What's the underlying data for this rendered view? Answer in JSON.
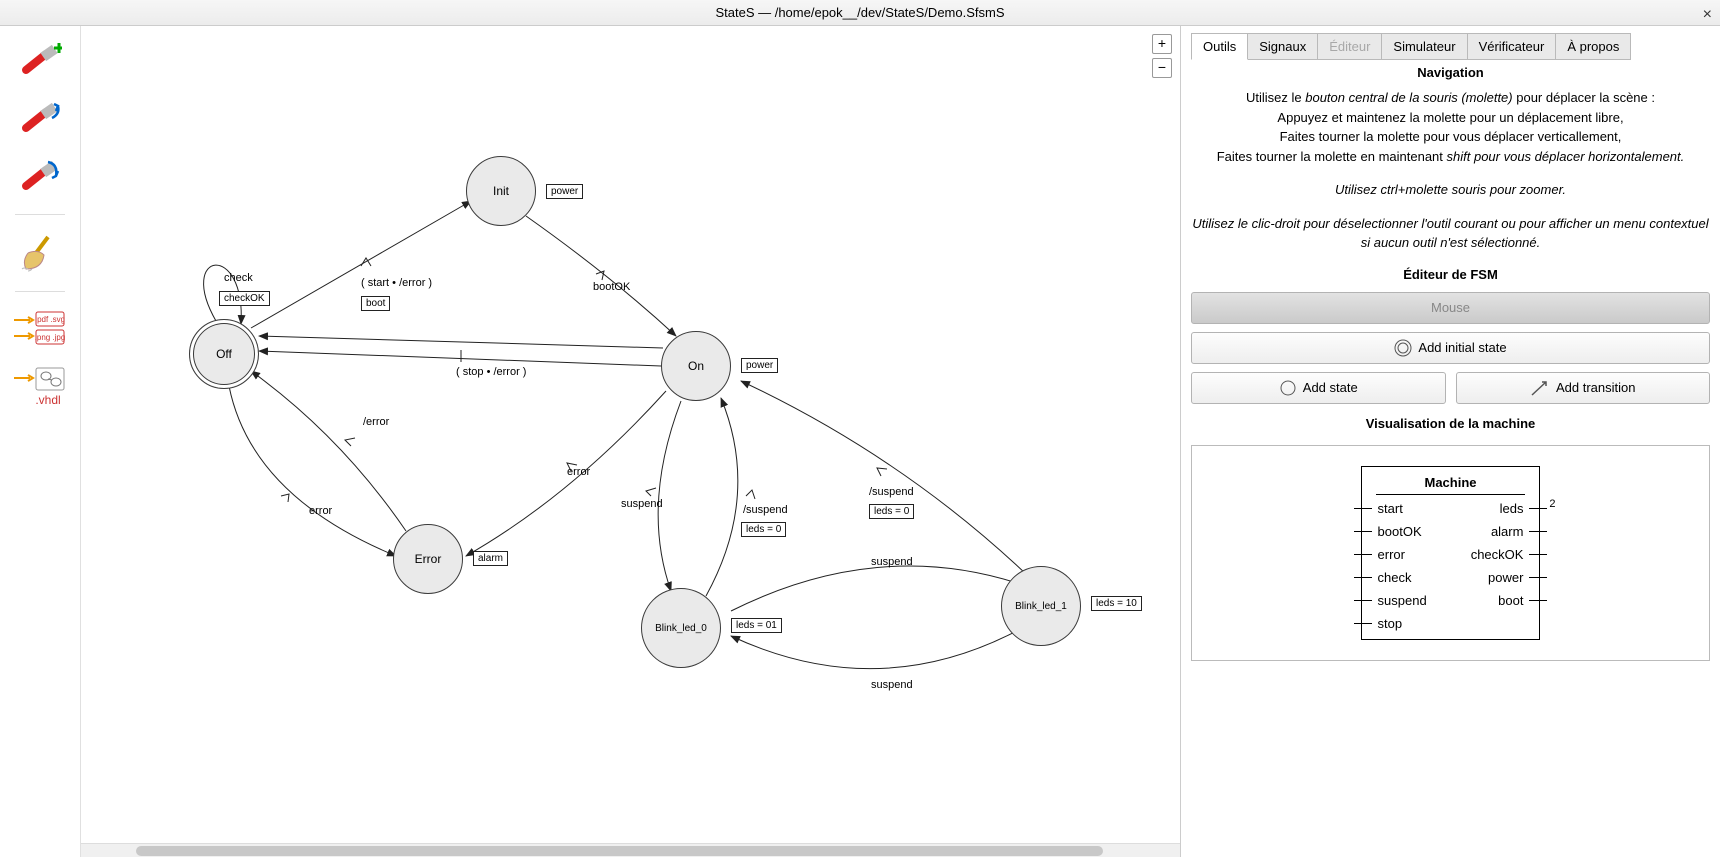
{
  "window": {
    "title": "StateS — /home/epok__/dev/StateS/Demo.SfsmS"
  },
  "zoom": {
    "in": "+",
    "out": "−"
  },
  "states": {
    "init": "Init",
    "off": "Off",
    "on": "On",
    "error": "Error",
    "bl0": "Blink_led_0",
    "bl1": "Blink_led_1"
  },
  "outputs": {
    "init": "power",
    "on": "power",
    "error": "alarm",
    "bl0": "leds = 01",
    "bl1": "leds = 10"
  },
  "edges": {
    "off_self_c": "check",
    "off_self_a": "checkOK",
    "off_init_c": "( start • /error )",
    "off_init_a": "boot",
    "init_on": "bootOK",
    "on_off": "( stop • /error )",
    "on_err_c": "/error",
    "off_err_a": "error",
    "err_off": "error",
    "on_bl0_c": "suspend",
    "bl0_on_c": "/suspend",
    "bl0_on_a": "leds = 0",
    "bl1_on_c": "/suspend",
    "bl1_on_a": "leds = 0",
    "bl0_bl1": "suspend",
    "bl1_bl0": "suspend"
  },
  "tabs": [
    "Outils",
    "Signaux",
    "Éditeur",
    "Simulateur",
    "Vérificateur",
    "À propos"
  ],
  "nav": {
    "head": "Navigation",
    "l1a": "Utilisez le ",
    "l1b": "bouton central de la souris (molette)",
    "l1c": " pour déplacer la scène :",
    "l2": "Appuyez et maintenez la molette pour un déplacement libre,",
    "l3": "Faites tourner la molette pour vous déplacer verticallement,",
    "l4a": "Faites tourner la molette en maintenant ",
    "l4b": "shift pour vous déplacer horizontalement.",
    "l5a": "Utilisez ",
    "l5b": "ctrl+molette souris pour zoomer.",
    "l6a": "Utilisez le ",
    "l6b": "clic-droit pour déselectionner l'outil courant ou pour afficher un menu contextuel si aucun outil n'est sélectionné."
  },
  "editor": {
    "head": "Éditeur de FSM",
    "mouse": "Mouse",
    "addInit": "Add initial state",
    "addState": "Add state",
    "addTrans": "Add transition"
  },
  "vis": {
    "head": "Visualisation de la machine",
    "title": "Machine",
    "inputs": [
      "start",
      "bootOK",
      "error",
      "check",
      "suspend",
      "stop"
    ],
    "outputs": [
      "leds",
      "alarm",
      "checkOK",
      "power",
      "boot"
    ],
    "buswidth": "2"
  }
}
